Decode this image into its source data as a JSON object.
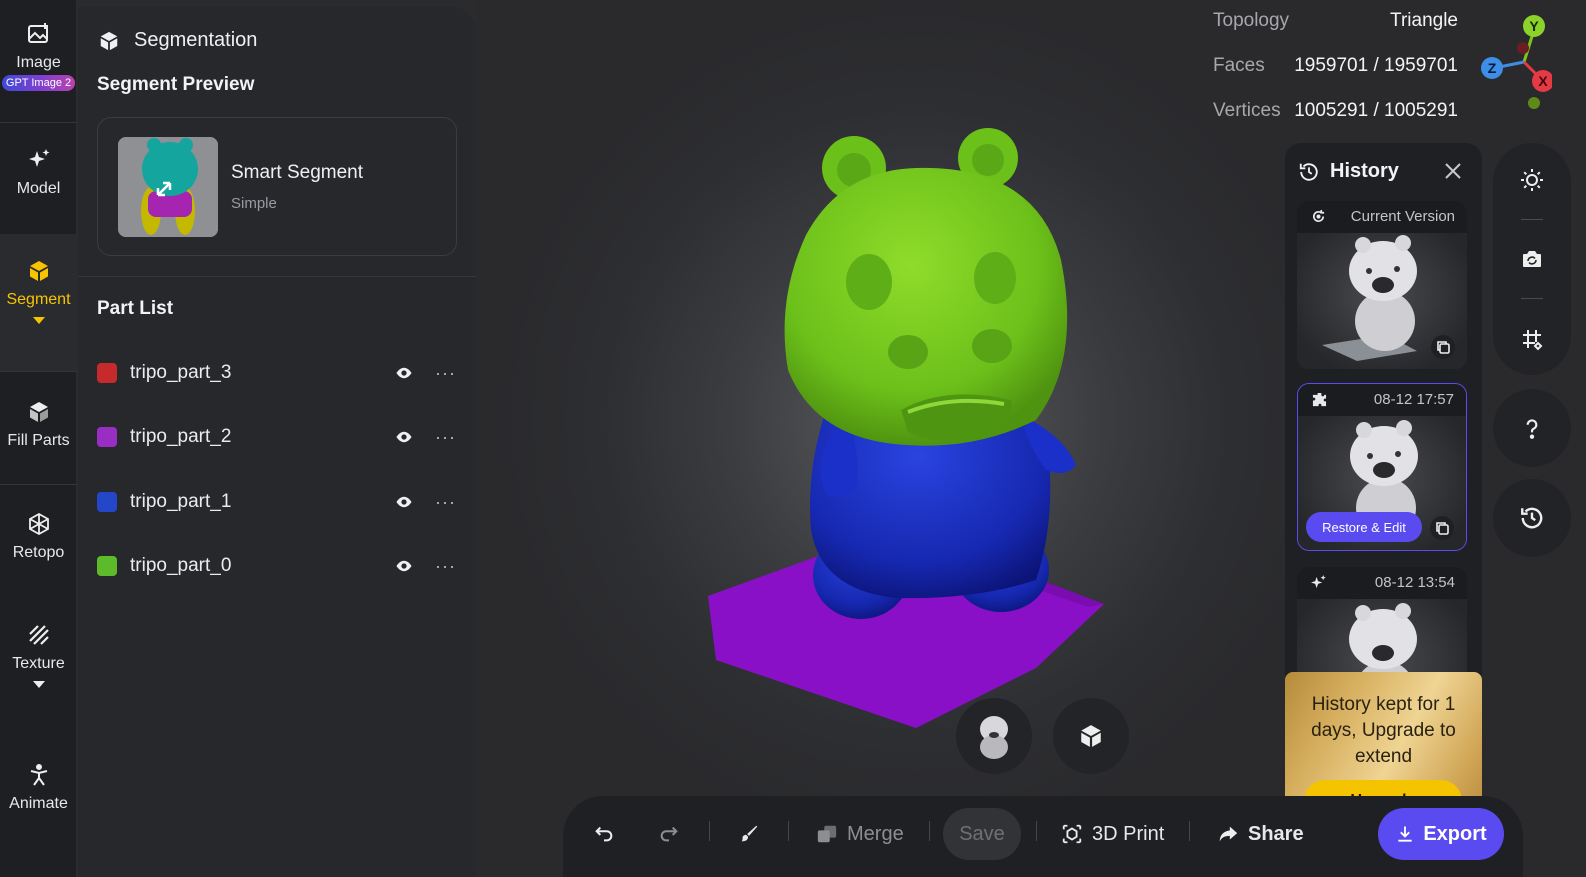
{
  "rail": {
    "items": [
      {
        "label": "Image",
        "badge": "GPT Image 2"
      },
      {
        "label": "Model"
      },
      {
        "label": "Segment"
      },
      {
        "label": "Fill Parts"
      },
      {
        "label": "Retopo"
      },
      {
        "label": "Texture"
      },
      {
        "label": "Animate"
      }
    ],
    "active": "Segment",
    "active_color": "#f7c400"
  },
  "panel": {
    "title": "Segmentation",
    "preview_title": "Segment Preview",
    "preview": {
      "name": "Smart Segment",
      "sub": "Simple"
    },
    "part_list_title": "Part List",
    "parts": [
      {
        "name": "tripo_part_3",
        "color": "#c62a2a"
      },
      {
        "name": "tripo_part_2",
        "color": "#9a2ec2"
      },
      {
        "name": "tripo_part_1",
        "color": "#2446c8"
      },
      {
        "name": "tripo_part_0",
        "color": "#5dbb2b"
      }
    ]
  },
  "stats": {
    "topology_label": "Topology",
    "topology_value": "Triangle",
    "faces_label": "Faces",
    "faces_value": "1959701 / 1959701",
    "vertices_label": "Vertices",
    "vertices_value": "1005291 / 1005291"
  },
  "gizmo": {
    "y": "Y",
    "z": "Z",
    "x": "X"
  },
  "history": {
    "title": "History",
    "versions": [
      {
        "label": "Current Version"
      },
      {
        "label": "08-12 17:57",
        "action": "Restore & Edit"
      },
      {
        "label": "08-12 13:54"
      }
    ],
    "upgrade_text": "History kept for 1 days, Upgrade to extend",
    "upgrade_button": "Upgrade"
  },
  "toolbar": {
    "merge": "Merge",
    "save": "Save",
    "print": "3D Print",
    "share": "Share",
    "export": "Export"
  },
  "colors": {
    "accent": "#5a4bf0",
    "upgrade": "#f5c400",
    "head": "#6fc21a",
    "body": "#1a2fc0",
    "base": "#8a10c8"
  }
}
